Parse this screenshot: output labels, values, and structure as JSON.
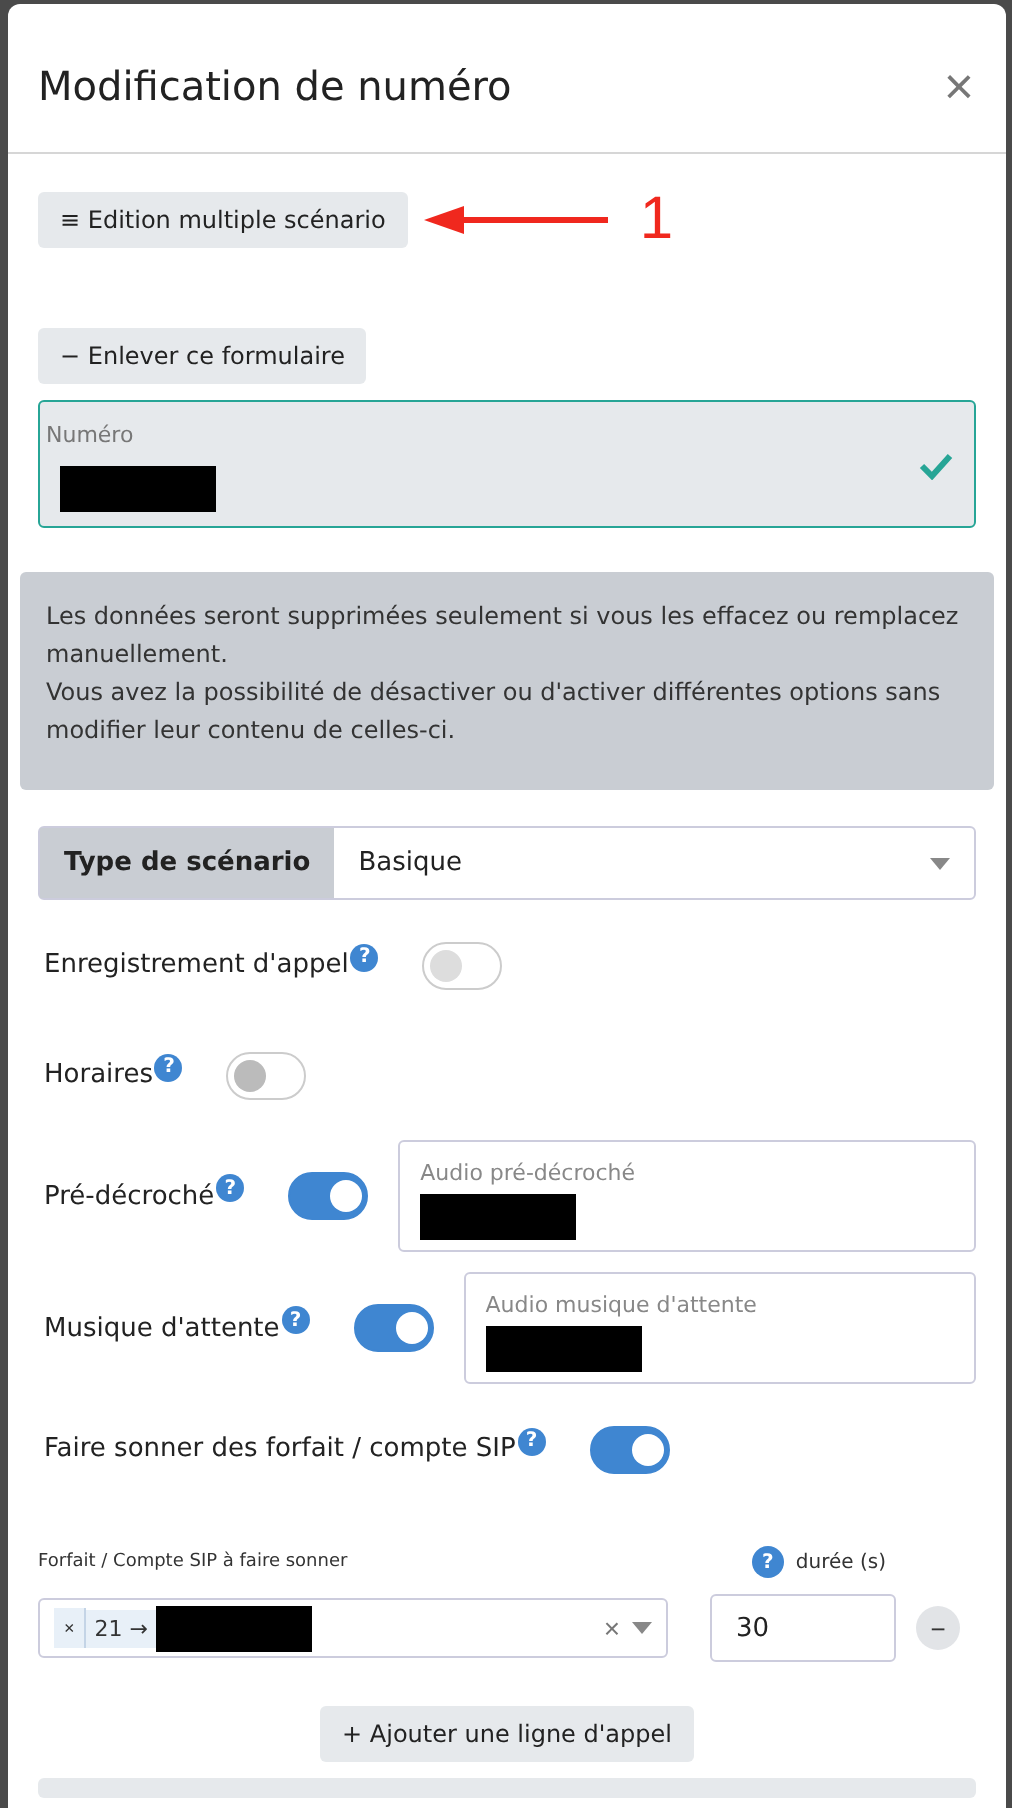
{
  "modal": {
    "title": "Modification de numéro",
    "close": "×"
  },
  "multi_edit_button": {
    "icon": "≡",
    "label": "Edition multiple scénario"
  },
  "annotation": {
    "label": "1"
  },
  "remove_form_button": {
    "icon": "−",
    "label": "Enlever ce formulaire"
  },
  "number_field": {
    "label": "Numéro",
    "valid": true
  },
  "info_message": [
    "Les données seront supprimées seulement si vous les effacez ou remplacez manuellement.",
    "Vous avez la possibilité de désactiver ou d'activer différentes options sans modifier leur contenu de celles-ci."
  ],
  "scenario_type": {
    "label": "Type de scénario",
    "value": "Basique"
  },
  "options": [
    {
      "kind": "toggle",
      "label": "Enregistrement d'appel",
      "help": "?",
      "on": false,
      "disabled": true
    },
    {
      "kind": "toggle",
      "label": "Horaires",
      "help": "?",
      "on": false,
      "disabled": false
    },
    {
      "kind": "audio",
      "label": "Pré-décroché",
      "help": "?",
      "on": true,
      "disabled": false,
      "field_label": "Audio pré-décroché"
    },
    {
      "kind": "audio",
      "label": "Musique d'attente",
      "help": "?",
      "on": true,
      "disabled": false,
      "field_label": "Audio musique d'attente"
    },
    {
      "kind": "toggle",
      "label": "Faire sonner des forfait / compte SIP",
      "help": "?",
      "on": true,
      "disabled": false
    }
  ],
  "ring_line": {
    "account_label": "Forfait / Compte SIP à faire sonner",
    "duration_help": "?",
    "duration_label": "durée (s)",
    "tag_remove": "×",
    "tag_value": "21 →",
    "clear": "×",
    "duration": "30",
    "remove": "−"
  },
  "add_line_button": {
    "icon": "+",
    "label": "Ajouter une ligne d'appel"
  }
}
